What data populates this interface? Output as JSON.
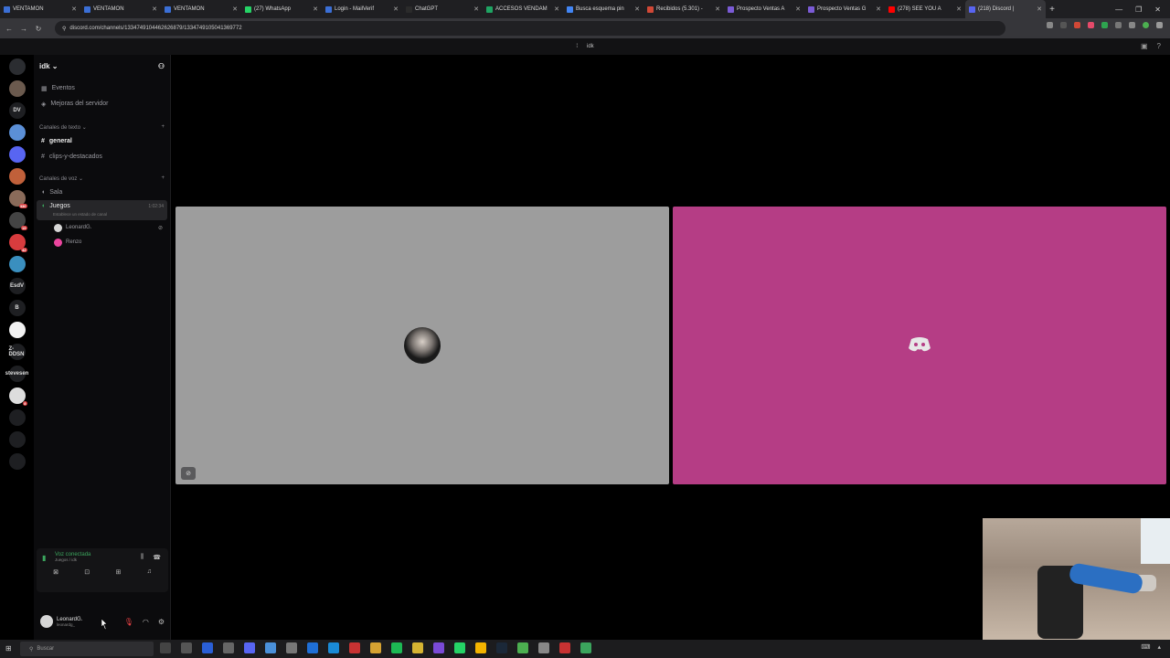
{
  "browser": {
    "tabs": [
      {
        "label": "VENTAMON",
        "color": "#3b6fd6"
      },
      {
        "label": "VENTAMON",
        "color": "#3b6fd6"
      },
      {
        "label": "VENTAMON",
        "color": "#3b6fd6"
      },
      {
        "label": "(27) WhatsApp",
        "color": "#25d366"
      },
      {
        "label": "Login - MailVerif",
        "color": "#3b6fd6"
      },
      {
        "label": "ChatGPT",
        "color": "#2b2b2b"
      },
      {
        "label": "ACCESOS VENDAM",
        "color": "#1fa463"
      },
      {
        "label": "Busca esquema pin",
        "color": "#4285f4"
      },
      {
        "label": "Recibidos (5.301) -",
        "color": "#d14836"
      },
      {
        "label": "Prospecto Ventas A",
        "color": "#7b5bd6"
      },
      {
        "label": "Prospecto Ventas G",
        "color": "#7b5bd6"
      },
      {
        "label": "(278) SEE YOU A",
        "color": "#ff0000"
      },
      {
        "label": "(218) Discord |",
        "color": "#5865f2"
      }
    ],
    "url": "discord.com/channels/1334749104462626879/1334749105041369772",
    "new_tab": "+",
    "window_controls": [
      "—",
      "❐",
      "✕"
    ]
  },
  "voice_header": {
    "channel_name": "idk"
  },
  "guilds": [
    {
      "label": "",
      "icon": "discord-home-icon",
      "color": "#2b2d31"
    },
    {
      "label": "",
      "icon": "server-avatar-1",
      "color": "#6b5a4e"
    },
    {
      "label": "DV",
      "icon": "server-dv",
      "color": "#1e1f22"
    },
    {
      "label": "",
      "icon": "server-avatar-2",
      "color": "#5b8fd6"
    },
    {
      "label": "",
      "icon": "server-avatar-3",
      "color": "#5865f2"
    },
    {
      "label": "",
      "icon": "server-avatar-4",
      "color": "#c0603a",
      "badge": ""
    },
    {
      "label": "",
      "icon": "server-avatar-5",
      "color": "#8a6b5a",
      "badge": "336"
    },
    {
      "label": "",
      "icon": "server-avatar-6",
      "color": "#444",
      "badge": "19"
    },
    {
      "label": "",
      "icon": "server-avatar-7",
      "color": "#d83c3e",
      "badge": "42"
    },
    {
      "label": "",
      "icon": "server-avatar-8",
      "color": "#3a8fbf"
    },
    {
      "label": "EsdV",
      "icon": "server-esdv",
      "color": "#1e1f22"
    },
    {
      "label": "B",
      "icon": "server-b",
      "color": "#1e1f22"
    },
    {
      "label": "",
      "icon": "server-avatar-9",
      "color": "#f2f2f2"
    },
    {
      "label": "Z-DDSN",
      "icon": "server-zddsn",
      "color": "#1e1f22"
    },
    {
      "label": "stevesen",
      "icon": "server-stevesen",
      "color": "#1e1f22"
    },
    {
      "label": "",
      "icon": "server-avatar-10",
      "color": "#ddd",
      "badge": "8"
    },
    {
      "label": "",
      "icon": "add-server-icon",
      "color": "#1e1f22"
    },
    {
      "label": "",
      "icon": "explore-icon",
      "color": "#1e1f22"
    },
    {
      "label": "",
      "icon": "download-icon",
      "color": "#1e1f22"
    }
  ],
  "sidebar": {
    "server_name": "idk",
    "top_items": [
      {
        "label": "Eventos",
        "icon": "calendar-icon"
      },
      {
        "label": "Mejoras del servidor",
        "icon": "boost-icon"
      }
    ],
    "text_category": "Canales de texto",
    "text_channels": [
      {
        "label": "general",
        "bright": true
      },
      {
        "label": "clips-y-destacados",
        "bright": false
      }
    ],
    "voice_category": "Canales de voz",
    "voice_channels": [
      {
        "label": "Sala"
      },
      {
        "label": "Juegos",
        "time": "1:02:34",
        "status": "Establece un estado de canal"
      }
    ],
    "voice_users": [
      {
        "name": "LeonardG.",
        "color": "#d6d6d6"
      },
      {
        "name": "Renzo",
        "color": "#eb459e"
      }
    ]
  },
  "voice_panel": {
    "title": "Voz conectada",
    "subtitle": "Juegos / idk"
  },
  "user_panel": {
    "name": "LeonardG.",
    "tag": "leonardg_"
  },
  "stage": {
    "tile1_color": "#9d9d9d",
    "tile2_color": "#b53d85"
  },
  "taskbar": {
    "search_placeholder": "Buscar"
  }
}
